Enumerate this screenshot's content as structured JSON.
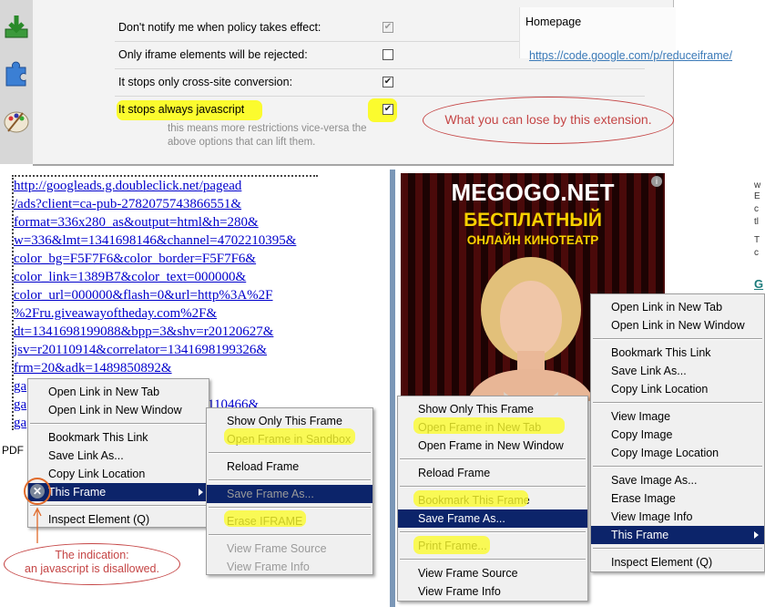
{
  "options": {
    "rows": [
      {
        "label": "Don't notify me when policy takes effect:",
        "checked": true,
        "disabled": true
      },
      {
        "label": "Only iframe elements will be rejected:",
        "checked": false,
        "disabled": false
      },
      {
        "label": "It stops only cross-site conversion:",
        "checked": true,
        "disabled": false
      },
      {
        "label": "It stops always javascript",
        "checked": true,
        "disabled": false
      }
    ],
    "note_line1": "this means more restrictions vice-versa the",
    "note_line2": "above options that can lift them.",
    "homepage_label": "Homepage",
    "homepage_link": "https://code.google.com/p/reduceiframe/"
  },
  "callouts": {
    "top": "What you can lose by this extension.",
    "bottom_line1": "The indication:",
    "bottom_line2": "an javascript is disallowed."
  },
  "code_lines": [
    "http://googleads.g.doubleclick.net/pagead",
    "/ads?client=ca-pub-2782075743866551&",
    "format=336x280_as&output=html&h=280&",
    "w=336&lmt=1341698146&channel=4702210395&",
    "color_bg=F5F7F6&color_border=F5F7F6&",
    "color_link=1389B7&color_text=000000&",
    "color_url=000000&flash=0&url=http%3A%2F",
    "%2Fru.giveawayoftheday.com%2F&",
    "dt=1341698199088&bpp=3&shv=r20120627&",
    "jsv=r20110914&correlator=1341698199326&",
    "frm=20&adk=1489850892&",
    "ga",
    "ga",
    "ga"
  ],
  "code_fragment": "110466&",
  "pdf_label": "PDF",
  "ad": {
    "brand": "MEGOGO.NET",
    "line1": "БЕСПЛАТНЫЙ",
    "line2": "ОНЛАЙН КИНОТЕАТР",
    "info": "i"
  },
  "menu_left": [
    {
      "label": "Open Link in New Tab"
    },
    {
      "label": "Open Link in New Window"
    },
    {
      "sep": true
    },
    {
      "label": "Bookmark This Link"
    },
    {
      "label": "Save Link As..."
    },
    {
      "label": "Copy Link Location"
    },
    {
      "label": "This Frame",
      "selected": true,
      "submenu": true
    },
    {
      "sep": true
    },
    {
      "label": "Inspect Element (Q)"
    }
  ],
  "menu_left_sub": [
    {
      "label": "Show Only This Frame"
    },
    {
      "label": "Open Frame in Sandbox"
    },
    {
      "sep": true
    },
    {
      "label": "Reload Frame"
    },
    {
      "sep": true
    },
    {
      "label": "Save Frame As...",
      "selected": true,
      "disabled": true
    },
    {
      "sep": true
    },
    {
      "label": "Erase IFRAME"
    },
    {
      "sep": true
    },
    {
      "label": "View Frame Source",
      "disabled": true
    },
    {
      "label": "View Frame Info",
      "disabled": true
    }
  ],
  "menu_mid": [
    {
      "label": "Show Only This Frame"
    },
    {
      "label": "Open Frame in New Tab"
    },
    {
      "label": "Open Frame in New Window"
    },
    {
      "sep": true
    },
    {
      "label": "Reload Frame"
    },
    {
      "sep": true
    },
    {
      "label": "Bookmark This Frame"
    },
    {
      "label": "Save Frame As...",
      "selected": true
    },
    {
      "sep": true
    },
    {
      "label": "Print Frame..."
    },
    {
      "sep": true
    },
    {
      "label": "View Frame Source"
    },
    {
      "label": "View Frame Info"
    }
  ],
  "menu_right": [
    {
      "label": "Open Link in New Tab"
    },
    {
      "label": "Open Link in New Window"
    },
    {
      "sep": true
    },
    {
      "label": "Bookmark This Link"
    },
    {
      "label": "Save Link As..."
    },
    {
      "label": "Copy Link Location"
    },
    {
      "sep": true
    },
    {
      "label": "View Image"
    },
    {
      "label": "Copy Image"
    },
    {
      "label": "Copy Image Location"
    },
    {
      "sep": true
    },
    {
      "label": "Save Image As..."
    },
    {
      "label": "Erase Image"
    },
    {
      "label": "View Image Info"
    },
    {
      "label": "This Frame",
      "selected": true,
      "submenu": true
    },
    {
      "sep": true
    },
    {
      "label": "Inspect Element (Q)"
    }
  ],
  "right_edge": [
    "w",
    "E",
    "c",
    "tl",
    "",
    "T",
    "c",
    "",
    "G"
  ],
  "icons": {
    "download": "download-icon",
    "addons": "puzzle-icon",
    "appearance": "palette-icon",
    "disallowed": "x-icon"
  }
}
